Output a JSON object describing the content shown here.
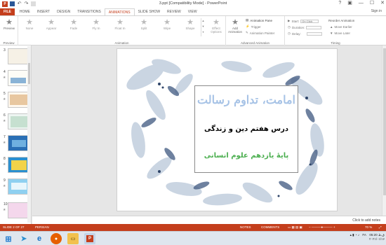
{
  "window": {
    "title": "3.ppt [Compatibility Mode] - PowerPoint",
    "controls": [
      "?",
      "▣",
      "—",
      "☐",
      "✕"
    ]
  },
  "tabs": [
    {
      "label": "FILE",
      "key": "file"
    },
    {
      "label": "HOME",
      "key": "home"
    },
    {
      "label": "INSERT",
      "key": "insert"
    },
    {
      "label": "DESIGN",
      "key": "design"
    },
    {
      "label": "TRANSITIONS",
      "key": "transitions"
    },
    {
      "label": "ANIMATIONS",
      "key": "animations"
    },
    {
      "label": "SLIDE SHOW",
      "key": "slideshow"
    },
    {
      "label": "REVIEW",
      "key": "review"
    },
    {
      "label": "VIEW",
      "key": "view"
    }
  ],
  "signin": "Sign in",
  "ribbon": {
    "preview": {
      "button": "Preview",
      "group": "Preview"
    },
    "animation": {
      "group": "Animation",
      "effects": [
        "None",
        "Appear",
        "Fade",
        "Fly In",
        "Float In",
        "Split",
        "Wipe",
        "Shape"
      ],
      "effect_options": "Effect Options"
    },
    "advanced": {
      "group": "Advanced Animation",
      "add_animation": "Add Animation",
      "animation_pane": "Animation Pane",
      "trigger": "Trigger",
      "animation_painter": "Animation Painter"
    },
    "timing": {
      "group": "Timing",
      "start_label": "Start:",
      "start_value": "On Click",
      "duration_label": "Duration:",
      "delay_label": "Delay:",
      "reorder_title": "Reorder Animation",
      "move_earlier": "Move Earlier",
      "move_later": "Move Later"
    }
  },
  "thumbnails": [
    {
      "num": "3"
    },
    {
      "num": "4"
    },
    {
      "num": "5"
    },
    {
      "num": "6"
    },
    {
      "num": "7"
    },
    {
      "num": "8"
    },
    {
      "num": "9"
    },
    {
      "num": "10"
    }
  ],
  "slide": {
    "title": "امامت، تداوم رسالت",
    "subtitle": "درس هفتم دین و زندگی",
    "grade": "پایۀ یازدهم علوم انسانی"
  },
  "notes_placeholder": "Click to add notes",
  "status": {
    "slide_of": "SLIDE 2 OF 27",
    "language": "PERSIAN",
    "notes": "NOTES",
    "comments": "COMMENTS",
    "zoom": "70 %"
  },
  "tray": {
    "lang": "FA",
    "time": "05:20 ق.ظ",
    "date": "۲۰۲۱/۰۱/۱۶"
  },
  "colors": {
    "accent": "#c43e1c",
    "title_blue": "#a7c3e6",
    "grade_green": "#4caf50"
  }
}
